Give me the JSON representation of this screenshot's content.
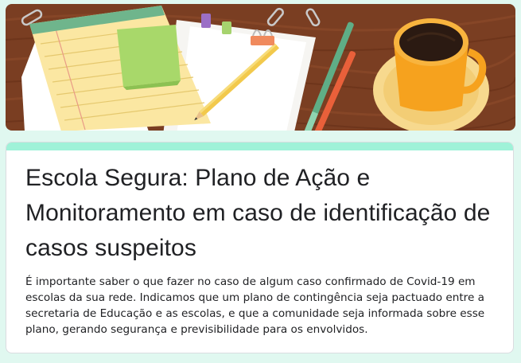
{
  "form": {
    "title": "Escola Segura: Plano de Ação e Monitoramento em caso de identificação de casos suspeitos",
    "description": "É importante saber o que fazer no caso de algum caso confirmado de Covid-19 em escolas da sua rede. Indicamos que um plano de contingência seja pactuado entre a secretaria de Educação e as escolas, e que a comunidade seja informada sobre esse plano, gerando segurança e previsibilidade para os envolvidos."
  },
  "theme": {
    "page_background": "#e0f8f0",
    "accent": "#9ff2d8",
    "banner_wood": "#7a3e22"
  }
}
